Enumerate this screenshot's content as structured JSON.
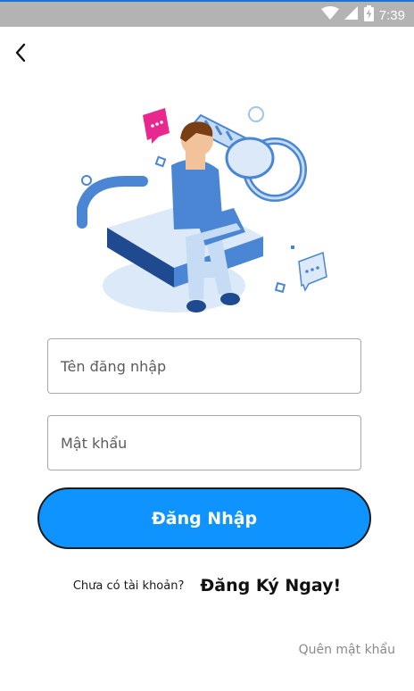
{
  "status_bar": {
    "time": "7:39",
    "icons": [
      "wifi-icon",
      "signal-icon",
      "battery-charging-icon"
    ]
  },
  "nav": {
    "back_icon": "chevron-left-icon"
  },
  "form": {
    "username_placeholder": "Tên đăng nhập",
    "password_placeholder": "Mật khẩu",
    "login_label": "Đăng Nhập"
  },
  "footer": {
    "no_account_text": "Chưa có tài khoản?",
    "register_label": "Đăng Ký Ngay!",
    "forgot_label": "Quên mật khẩu"
  },
  "colors": {
    "accent": "#0e93ff",
    "status_bar": "#b3b3b3",
    "illustration_blue": "#4a86d4",
    "illustration_pink": "#e8288f"
  }
}
